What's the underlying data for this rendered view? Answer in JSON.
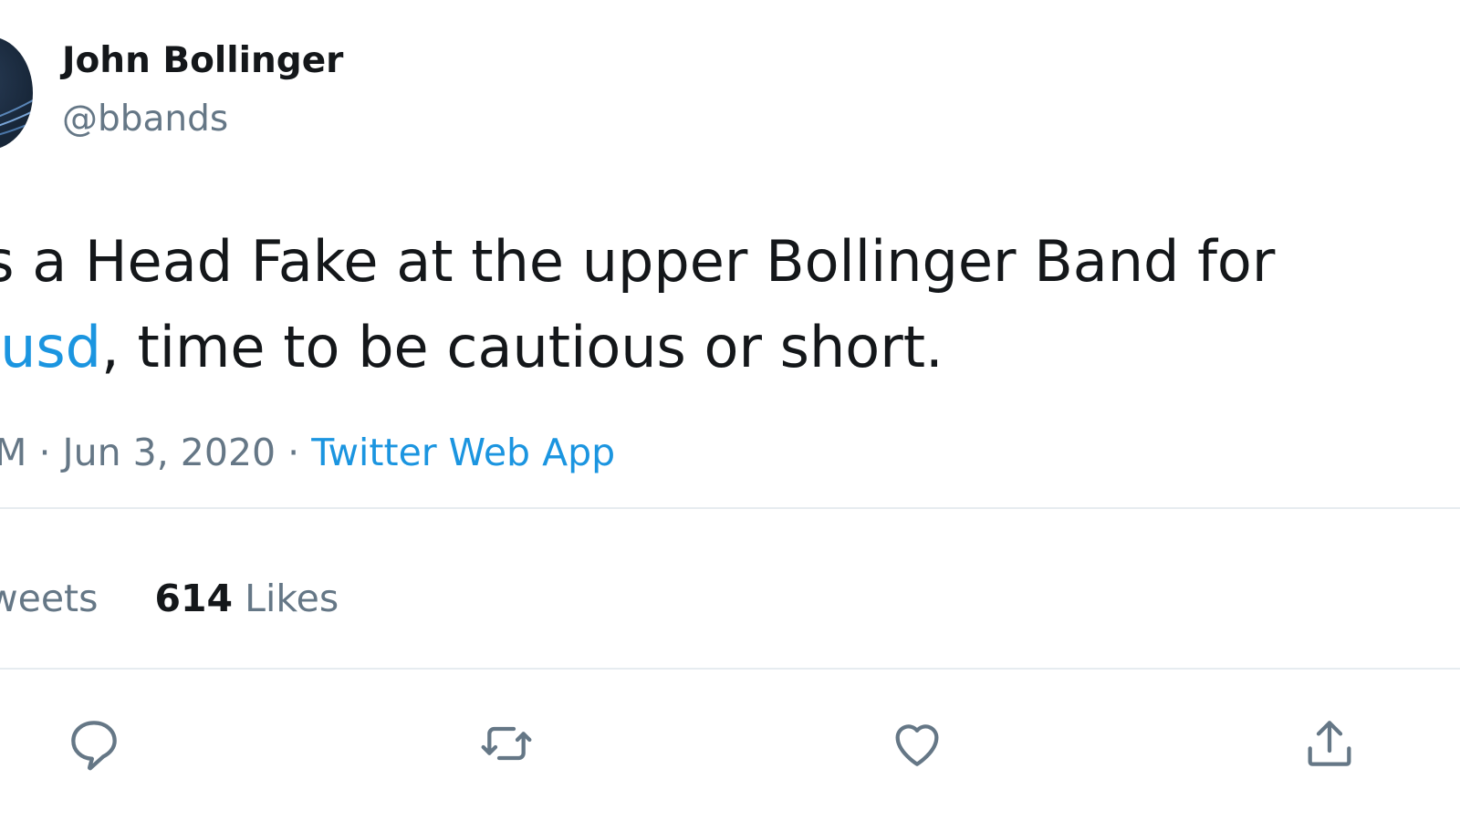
{
  "author": {
    "display_name": "John Bollinger",
    "handle": "@bbands"
  },
  "tweet": {
    "line1": "is a Head Fake at the upper Bollinger Band for",
    "cashtag": "cusd",
    "line2_rest": ", time to be cautious or short."
  },
  "meta": {
    "time_fragment": "AM",
    "separator": " · ",
    "date": "Jun 3, 2020",
    "source": "Twitter Web App"
  },
  "stats": {
    "retweets_label": "tweets",
    "likes_count": "614",
    "likes_label": "Likes"
  },
  "actions": {
    "reply_icon": "reply-icon",
    "retweet_icon": "retweet-icon",
    "like_icon": "heart-icon",
    "share_icon": "share-icon"
  },
  "colors": {
    "text": "#14171a",
    "secondary": "#657786",
    "accent": "#1b95e0",
    "divider": "#e6ecf0"
  }
}
